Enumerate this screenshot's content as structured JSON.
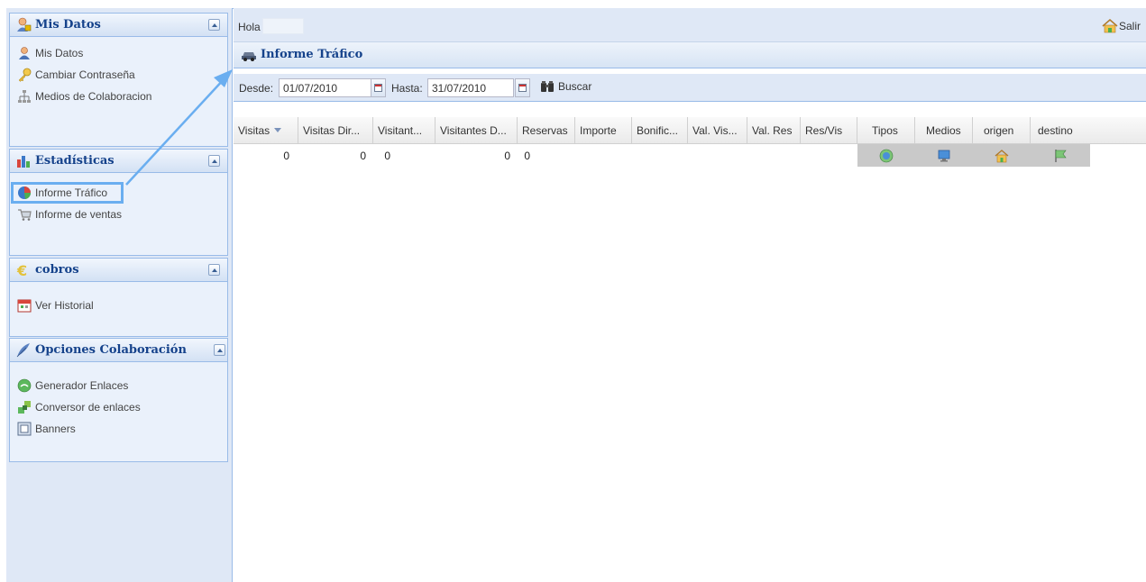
{
  "sidebar": {
    "panels": [
      {
        "title": "Mis Datos",
        "icon": "user-lock-icon",
        "items": [
          {
            "label": "Mis Datos",
            "icon": "user-icon"
          },
          {
            "label": "Cambiar Contraseña",
            "icon": "key-icon"
          },
          {
            "label": "Medios de Colaboracion",
            "icon": "network-icon"
          }
        ]
      },
      {
        "title": "Estadísticas",
        "icon": "bar-chart-icon",
        "items": [
          {
            "label": "Informe Tráfico",
            "icon": "pie-chart-icon",
            "selected": true
          },
          {
            "label": "Informe de ventas",
            "icon": "cart-icon"
          }
        ]
      },
      {
        "title": "cobros",
        "icon": "euro-icon",
        "items": [
          {
            "label": "Ver Historial",
            "icon": "calendar-icon"
          }
        ]
      },
      {
        "title": "Opciones Colaboración",
        "icon": "feather-icon",
        "items": [
          {
            "label": "Generador Enlaces",
            "icon": "globe-link-icon"
          },
          {
            "label": "Conversor de enlaces",
            "icon": "convert-icon"
          },
          {
            "label": "Banners",
            "icon": "banner-icon"
          }
        ]
      }
    ]
  },
  "topbar": {
    "greeting": "Hola",
    "logout_label": "Salir"
  },
  "report": {
    "title": "Informe Tráfico"
  },
  "toolbar": {
    "desde_label": "Desde:",
    "desde_value": "01/07/2010",
    "hasta_label": "Hasta:",
    "hasta_value": "31/07/2010",
    "search_label": "Buscar"
  },
  "grid": {
    "columns": [
      "Visitas",
      "Visitas Dir...",
      "Visitant...",
      "Visitantes D...",
      "Reservas",
      "Importe",
      "Bonific...",
      "Val. Vis...",
      "Val. Res",
      "Res/Vis",
      "Tipos",
      "Medios",
      "origen",
      "destino"
    ],
    "sorted_column": "Visitas",
    "rows": [
      {
        "cells": [
          "0",
          "0",
          "0",
          "0",
          "0",
          "",
          "",
          "",
          "",
          "",
          "",
          "",
          "",
          ""
        ],
        "icons": [
          "globe-icon",
          "monitor-icon",
          "home-icon",
          "flag-icon"
        ]
      }
    ]
  },
  "colors": {
    "accent": "#15428b",
    "panel_bg": "#dfe8f6",
    "border": "#99bbe8",
    "highlight": "#6aaef0"
  }
}
